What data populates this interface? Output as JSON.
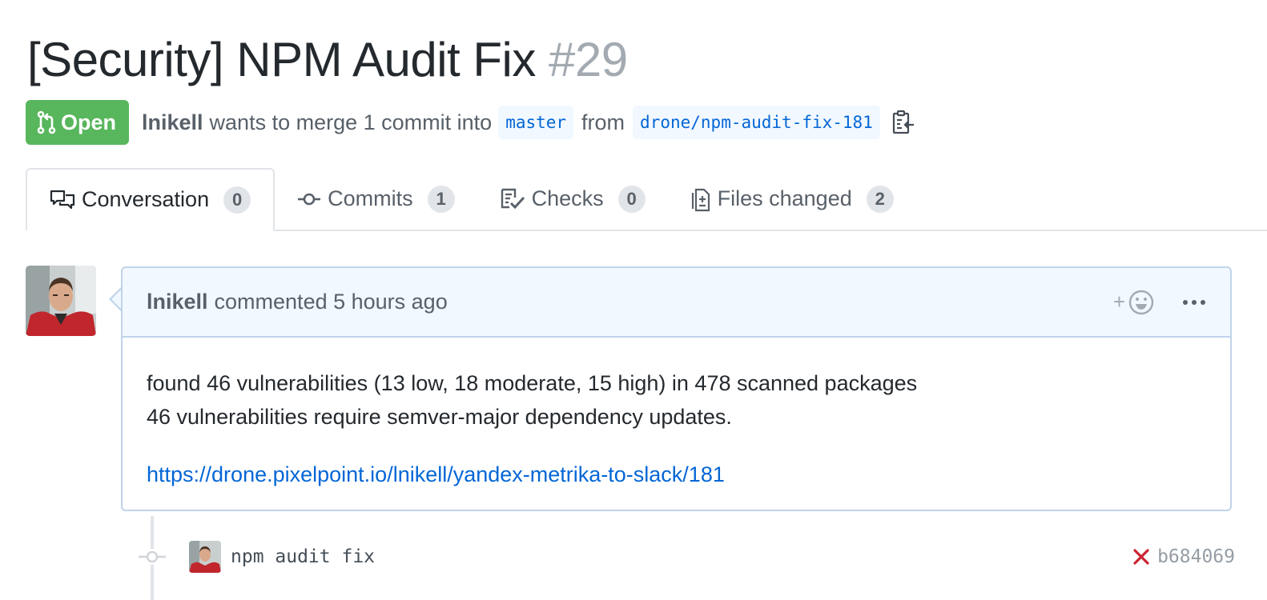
{
  "pull_request": {
    "title": "[Security] NPM Audit Fix",
    "number": "#29",
    "state": "Open",
    "author": "lnikell",
    "merge_text": "wants to merge 1 commit into",
    "base_branch": "master",
    "from_text": "from",
    "head_branch": "drone/npm-audit-fix-181"
  },
  "tabs": [
    {
      "label": "Conversation",
      "count": "0",
      "icon": "comment-discussion-icon",
      "selected": true
    },
    {
      "label": "Commits",
      "count": "1",
      "icon": "git-commit-icon",
      "selected": false
    },
    {
      "label": "Checks",
      "count": "0",
      "icon": "checklist-icon",
      "selected": false
    },
    {
      "label": "Files changed",
      "count": "2",
      "icon": "diff-icon",
      "selected": false
    }
  ],
  "comment": {
    "author": "lnikell",
    "meta": "commented 5 hours ago",
    "reaction_label": "+",
    "body_line1": "found 46 vulnerabilities (13 low, 18 moderate, 15 high) in 478 scanned packages",
    "body_line2": "46 vulnerabilities require semver-major dependency updates.",
    "link": "https://drone.pixelpoint.io/lnikell/yandex-metrika-to-slack/181"
  },
  "commit": {
    "message": "npm audit fix",
    "sha": "b684069",
    "status": "failure"
  },
  "colors": {
    "open_green": "#58b65c",
    "link_blue": "#0366d6",
    "failure_red": "#cb2431",
    "comment_header_bg": "#f1f8ff"
  }
}
